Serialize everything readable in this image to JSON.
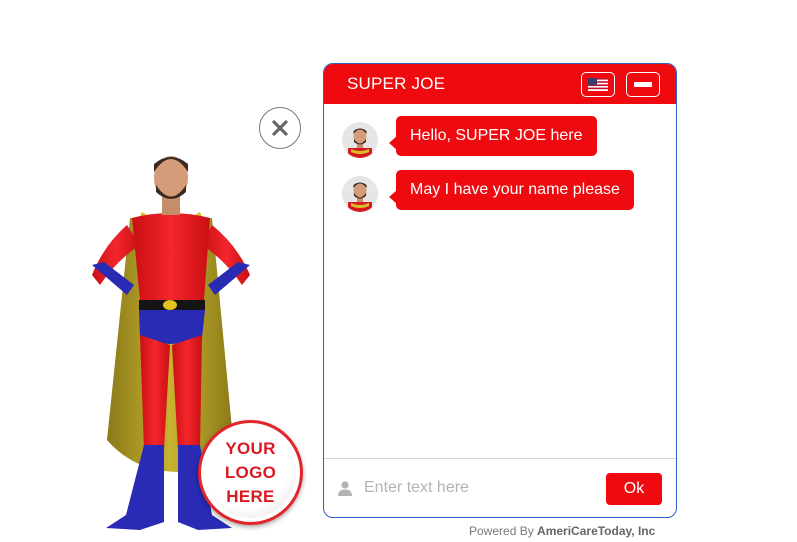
{
  "chat": {
    "title": "SUPER JOE",
    "language_icon": "us-flag-icon",
    "minimize_icon": "minimize-icon",
    "messages": [
      {
        "text": "Hello, SUPER JOE here"
      },
      {
        "text": "May I have your name please"
      }
    ],
    "input": {
      "placeholder": "Enter text here",
      "value": ""
    },
    "ok_label": "Ok"
  },
  "logo_badge": {
    "text": "YOUR\nLOGO\nHERE"
  },
  "footer": {
    "prefix": "Powered By ",
    "brand": "AmeriCareToday, Inc"
  },
  "colors": {
    "accent": "#ee0a0f",
    "border": "#2f5fc6"
  }
}
